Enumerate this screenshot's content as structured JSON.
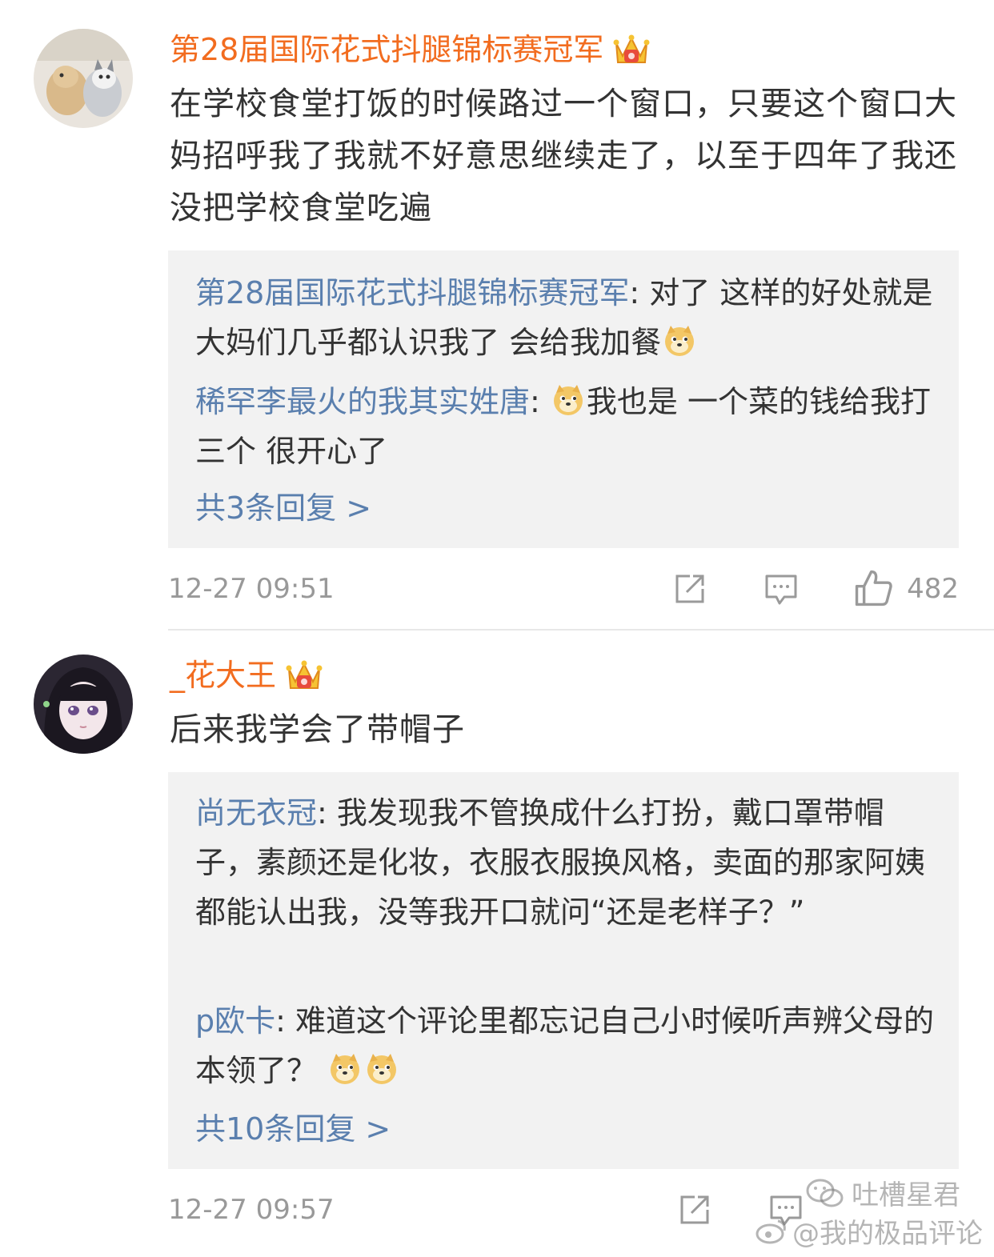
{
  "comments": [
    {
      "username": "第28届国际花式抖腿锦标赛冠军",
      "text": "在学校食堂打饭的时候路过一个窗口，只要这个窗口大妈招呼我了我就不好意思继续走了，以至于四年了我还没把学校食堂吃遍",
      "replies": [
        {
          "name": "第28届国际花式抖腿锦标赛冠军",
          "sep": ":",
          "pre": "",
          "text": " 对了 这样的好处就是大妈们几乎都认识我了 会给我加餐",
          "post_emoji": 1
        },
        {
          "name": "稀罕李最火的我其实姓唐",
          "sep": ":",
          "pre_emoji": 1,
          "text": "我也是 一个菜的钱给我打三个 很开心了"
        }
      ],
      "more": "共3条回复 >",
      "time": "12-27 09:51",
      "likes": "482"
    },
    {
      "username": "_花大王",
      "text": "后来我学会了带帽子",
      "replies": [
        {
          "name": "尚无衣冠",
          "sep": ":",
          "text": " 我发现我不管换成什么打扮，戴口罩带帽子，素颜还是化妆，衣服衣服换风格，卖面的那家阿姨都能认出我，没等我开口就问“还是老样子？”"
        },
        {
          "name": "p欧卡",
          "sep": ":",
          "text": " 难道这个评论里都忘记自己小时候听声辨父母的本领了？",
          "post_emoji": 2
        }
      ],
      "more": "共10条回复 >",
      "time": "12-27 09:57"
    }
  ],
  "watermark": {
    "line1": "吐槽星君",
    "line2": "@我的极品评论"
  },
  "icons": [
    "share-icon",
    "comment-icon",
    "like-icon",
    "crown-badge-icon",
    "doge-emoji-icon"
  ],
  "colors": {
    "username": "#f26c1f",
    "reply_name": "#5a7fae",
    "meta": "#999999"
  }
}
